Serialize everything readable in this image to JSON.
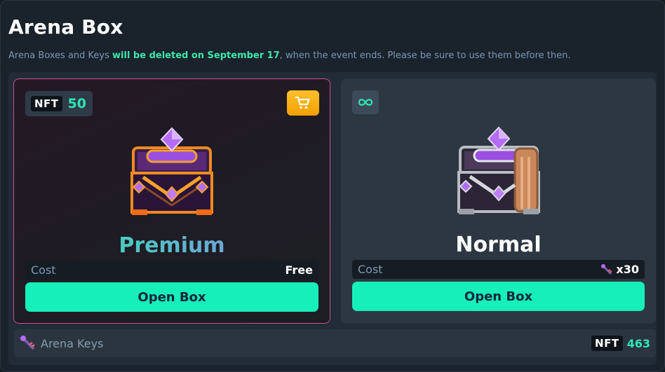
{
  "page": {
    "title": "Arena Box",
    "notice_prefix": "Arena Boxes and Keys ",
    "notice_highlight": "will be deleted on September 17",
    "notice_suffix": ", when the event ends. Please be sure to use them before then."
  },
  "premium": {
    "nft_tag": "NFT",
    "nft_count": "50",
    "name": "Premium",
    "cost_label": "Cost",
    "cost_value": "Free",
    "button_label": "Open Box",
    "cart_icon": "cart-icon"
  },
  "normal": {
    "badge_icon": "infinity-icon",
    "name": "Normal",
    "cost_label": "Cost",
    "cost_value": "x30",
    "cost_icon": "arena-key-icon",
    "button_label": "Open Box"
  },
  "keys": {
    "label": "Arena Keys",
    "nft_tag": "NFT",
    "count": "463",
    "icon": "arena-key-icon"
  },
  "colors": {
    "accent": "#16efb9",
    "teal_text": "#2ee6b4",
    "premium_border": "#c94e8f",
    "cart_button": "#f2a100"
  }
}
